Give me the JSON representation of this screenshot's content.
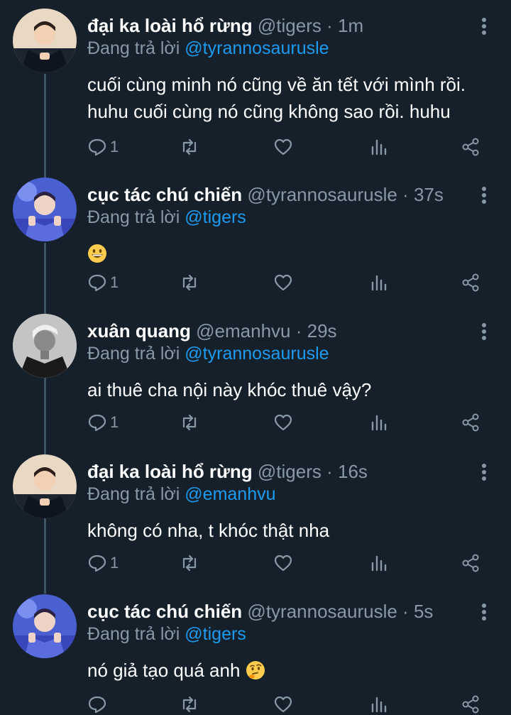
{
  "tweets": [
    {
      "name": "đại ka loài hổ rừng",
      "handle": "@tigers",
      "time": "1m",
      "reply_prefix": "Đang trả lời",
      "reply_to": "@tyrannosaurusle",
      "body_lines": [
        "cuối cùng minh nó cũng về ăn tết với mình rồi.",
        "huhu cuối cùng nó cũng không sao rồi. huhu"
      ],
      "reply_count": "1",
      "avatar": "avatar-tigers"
    },
    {
      "name": "cục tác chú chiến",
      "handle": "@tyrannosaurusle",
      "time": "37s",
      "reply_prefix": "Đang trả lời",
      "reply_to": "@tigers",
      "emoji": "grinning-face-emoji",
      "reply_count": "1",
      "avatar": "avatar-tyrannosaurusle"
    },
    {
      "name": "xuân quang",
      "handle": "@emanhvu",
      "time": "29s",
      "reply_prefix": "Đang trả lời",
      "reply_to": "@tyrannosaurusle",
      "body_lines": [
        "ai thuê cha nội này khóc thuê vậy?"
      ],
      "reply_count": "1",
      "avatar": "avatar-emanhvu"
    },
    {
      "name": "đại ka loài hổ rừng",
      "handle": "@tigers",
      "time": "16s",
      "reply_prefix": "Đang trả lời",
      "reply_to": "@emanhvu",
      "body_lines": [
        "không có nha, t khóc thật nha"
      ],
      "reply_count": "1",
      "avatar": "avatar-tigers"
    },
    {
      "name": "cục tác chú chiến",
      "handle": "@tyrannosaurusle",
      "time": "5s",
      "reply_prefix": "Đang trả lời",
      "reply_to": "@tigers",
      "body_lines": [
        "nó giả tạo quá anh"
      ],
      "emoji": "thinking-face-emoji",
      "reply_count": "",
      "avatar": "avatar-tyrannosaurusle"
    }
  ],
  "icons": {
    "reply": "reply-icon",
    "retweet": "retweet-icon",
    "like": "heart-icon",
    "stats": "stats-icon",
    "share": "share-icon",
    "more": "more-icon"
  },
  "colors": {
    "background": "#15202b",
    "secondary_text": "#8899a6",
    "mention": "#1d9bf0",
    "thread_line": "#3d5466"
  }
}
